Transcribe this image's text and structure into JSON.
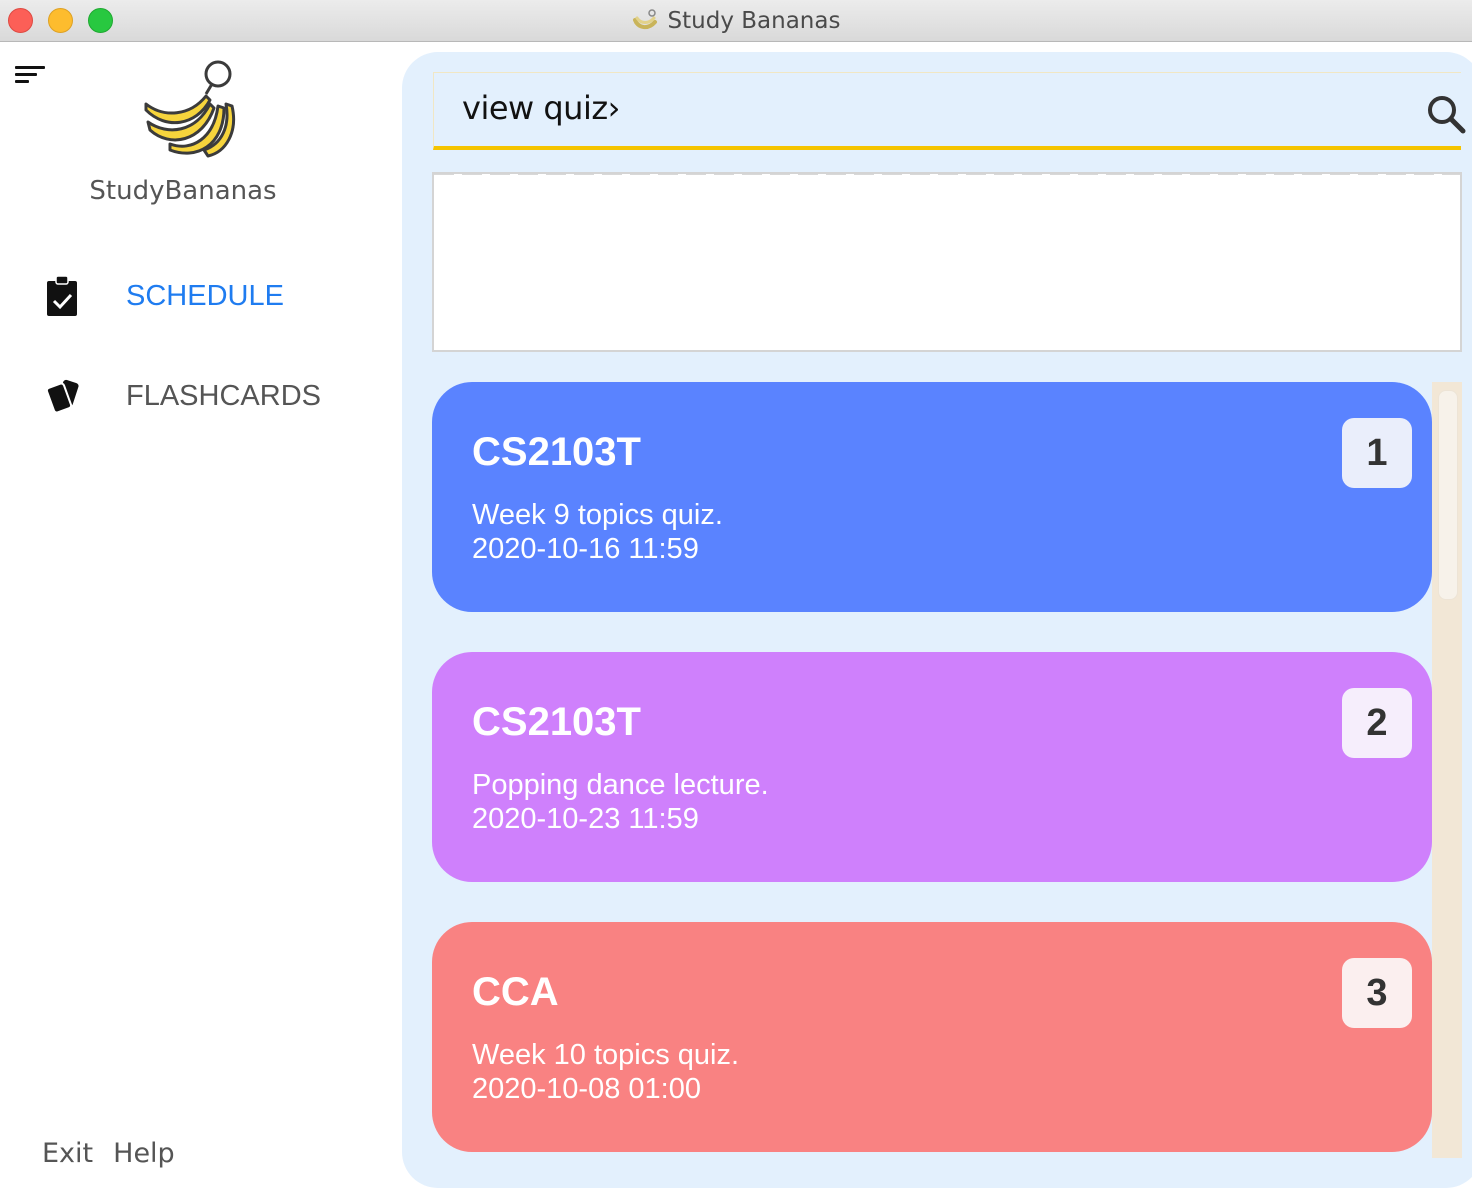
{
  "window": {
    "title": "Study Bananas"
  },
  "sidebar": {
    "app_name": "StudyBananas",
    "nav": [
      {
        "label": "SCHEDULE",
        "icon": "clipboard-check-icon",
        "active": true,
        "color": "#1f7cf0"
      },
      {
        "label": "FLASHCARDS",
        "icon": "cards-icon",
        "active": false,
        "color": "#555555"
      }
    ],
    "footer": {
      "exit_label": "Exit",
      "help_label": "Help"
    }
  },
  "search": {
    "value": "view quiz›",
    "icon": "search-icon"
  },
  "result": {
    "text": ""
  },
  "tasks": [
    {
      "title": "CS2103T",
      "description": "Week 9 topics quiz.",
      "datetime": "2020-10-16 11:59",
      "index": "1",
      "color": "#5a83ff",
      "badge_color": "#eaeefb"
    },
    {
      "title": "CS2103T",
      "description": "Popping dance lecture.",
      "datetime": "2020-10-23 11:59",
      "index": "2",
      "color": "#cf80fc",
      "badge_color": "#f6eefc"
    },
    {
      "title": "CCA",
      "description": "Week 10 topics quiz.",
      "datetime": "2020-10-08 01:00",
      "index": "3",
      "color": "#f98282",
      "badge_color": "#fbefef"
    }
  ]
}
